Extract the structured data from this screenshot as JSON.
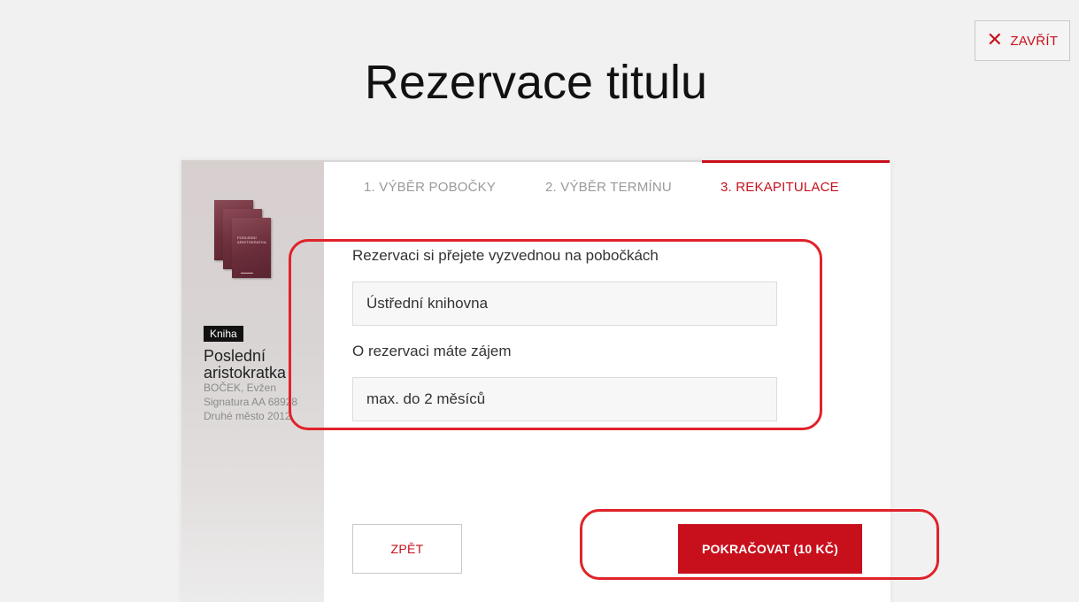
{
  "header": {
    "title": "Rezervace titulu",
    "close_label": "ZAVŘÍT"
  },
  "book": {
    "type_badge": "Kniha",
    "title": "Poslední aristokratka",
    "author": "BOČEK, Evžen",
    "signature": "Signatura AA 68928",
    "publisher": "Druhé město 2012",
    "cover_text": "POSLEDNÍ ARISTOKRATKA"
  },
  "steps": [
    {
      "label": "1. VÝBĚR POBOČKY",
      "active": false
    },
    {
      "label": "2. VÝBĚR TERMÍNU",
      "active": false
    },
    {
      "label": "3. REKAPITULACE",
      "active": true
    }
  ],
  "summary": {
    "branch_label": "Rezervaci si přejete vyzvednou na pobočkách",
    "branch_value": "Ústřední knihovna",
    "interest_label": "O rezervaci máte zájem",
    "interest_value": "max. do 2 měsíců"
  },
  "actions": {
    "back_label": "ZPĚT",
    "continue_label": "POKRAČOVAT (10 KČ)"
  },
  "colors": {
    "accent": "#c8101c",
    "highlight": "#e0222a",
    "background": "#f1f1f1"
  }
}
